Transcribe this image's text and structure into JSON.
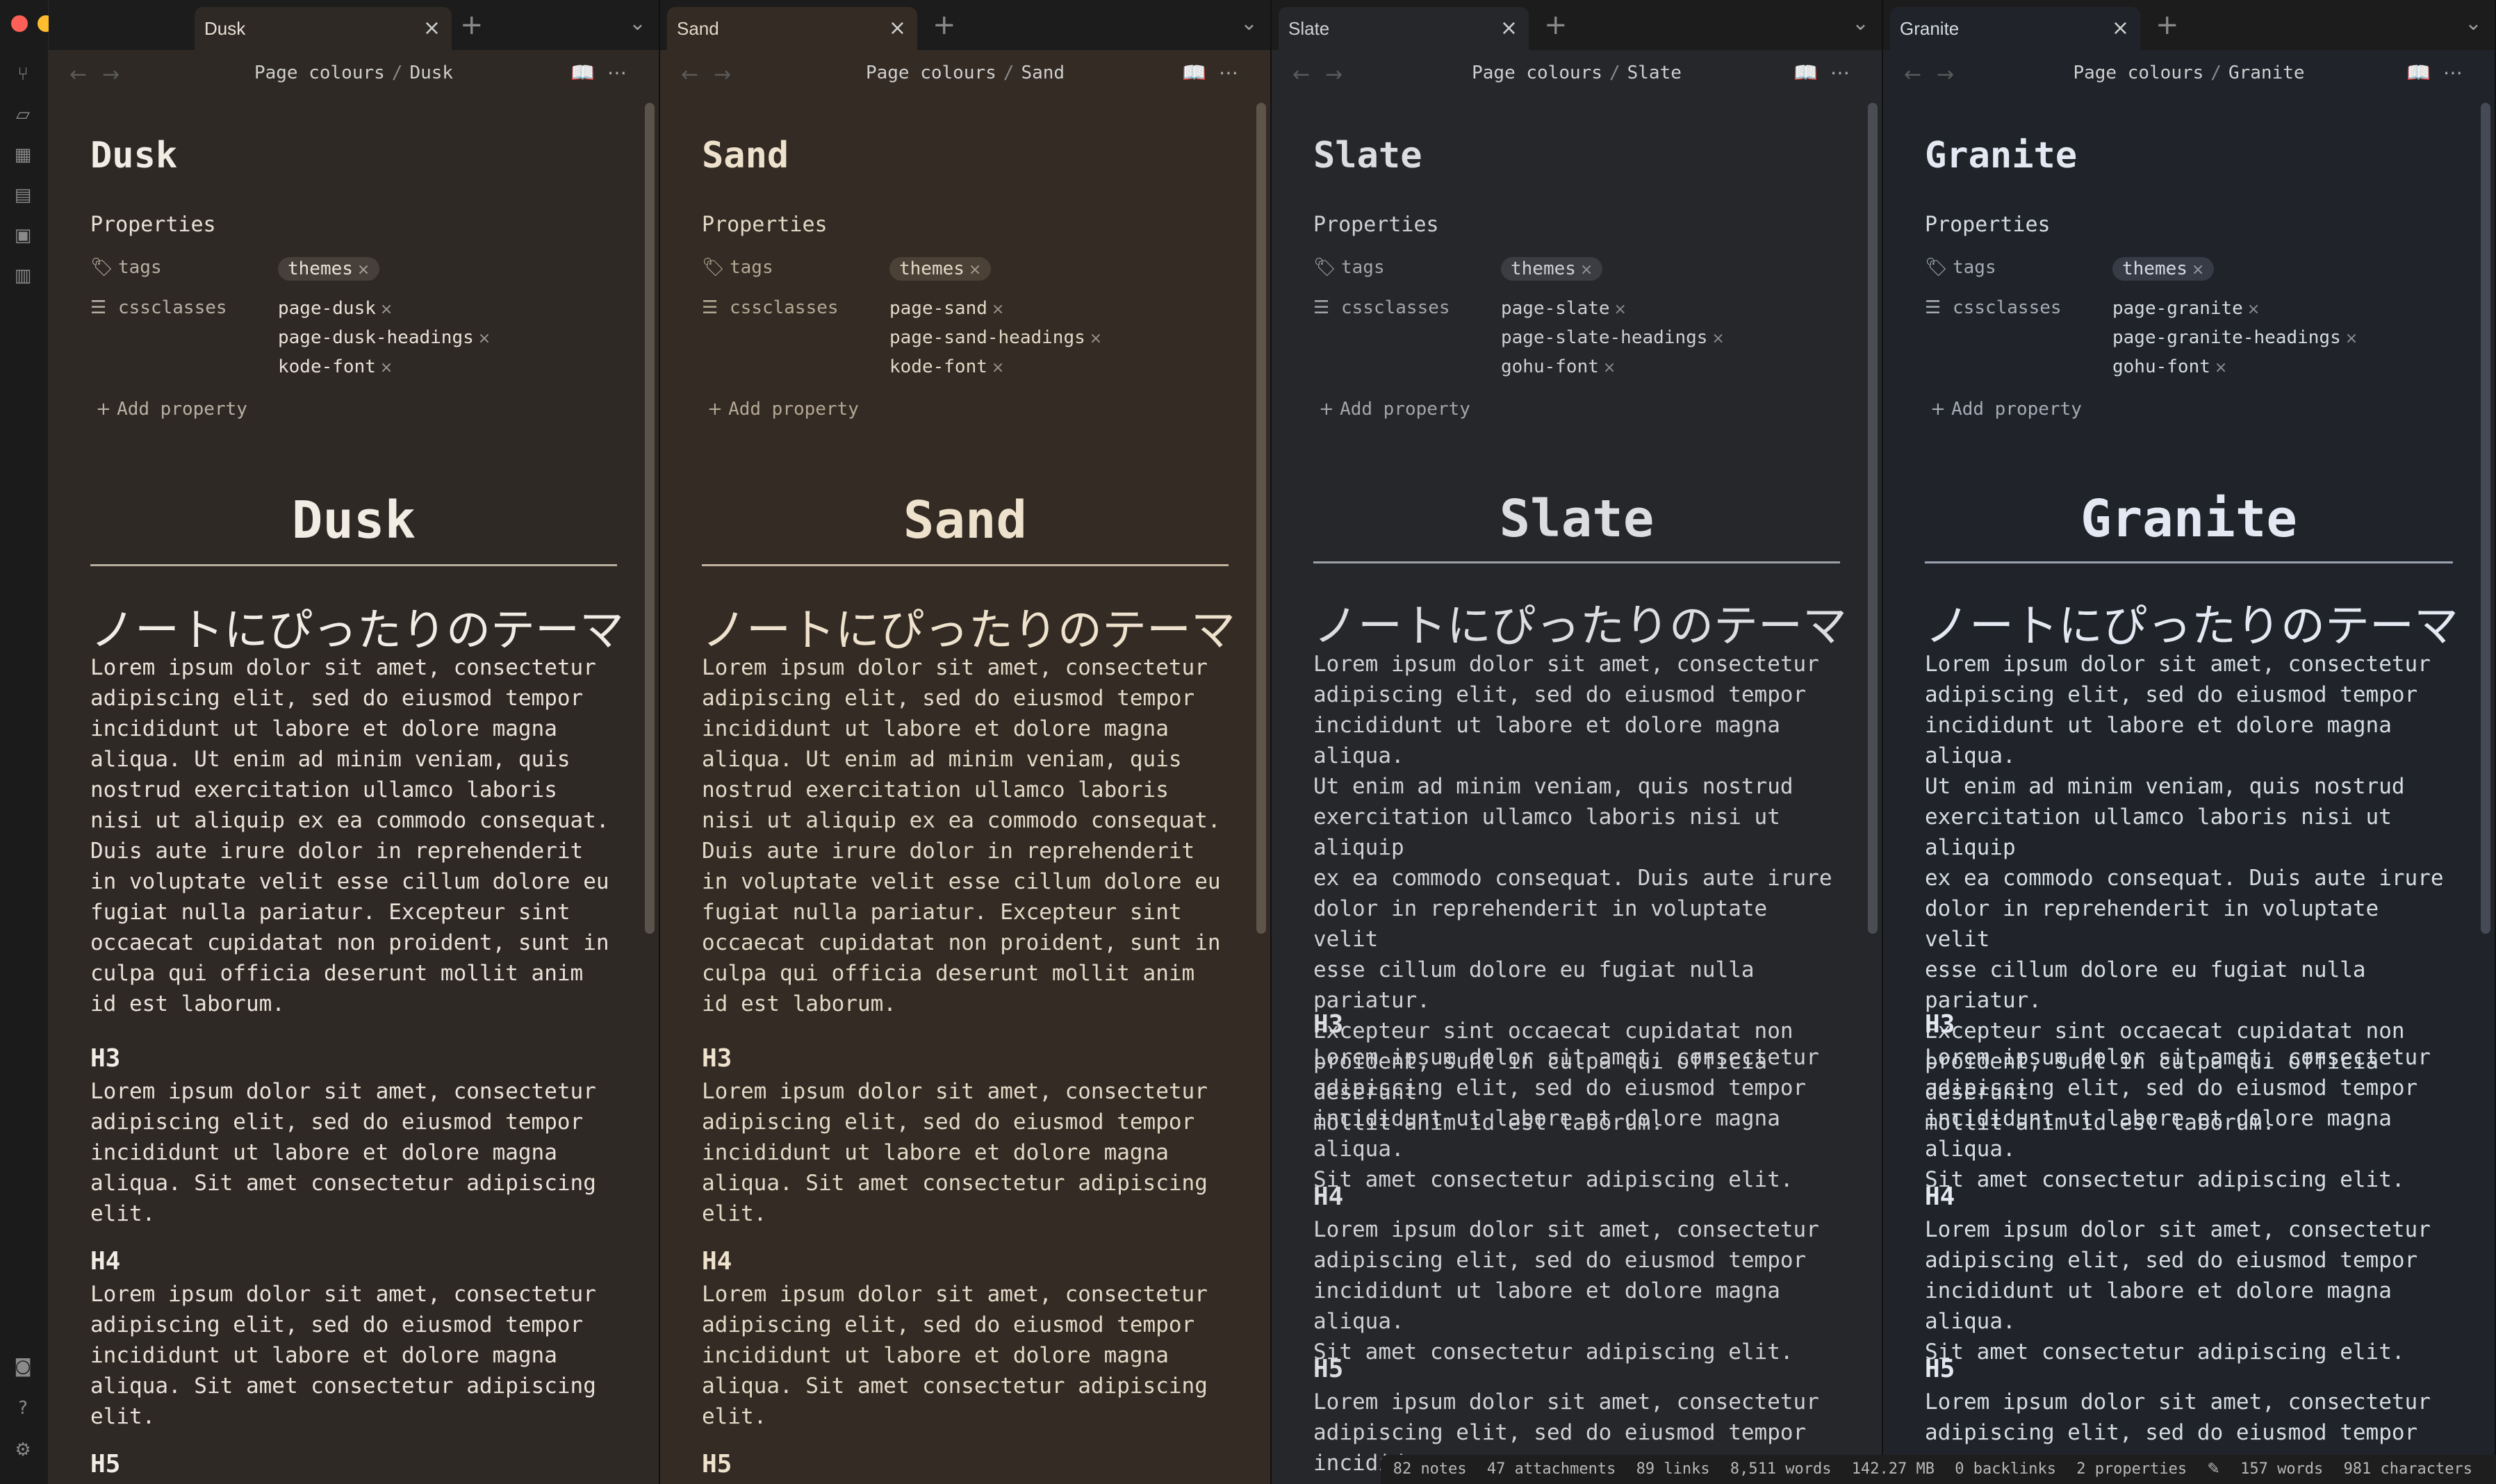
{
  "window": {
    "ribbon_icons": [
      "graph-icon",
      "canvas-icon",
      "grid-icon",
      "kanban-icon",
      "calendar-icon",
      "template-icon"
    ],
    "ribbon_bottom_icons": [
      "vault-icon",
      "help-icon",
      "settings-icon"
    ]
  },
  "panes": [
    {
      "id": "dusk",
      "tab_label": "Dusk",
      "breadcrumb_parent": "Page colours",
      "breadcrumb_separator": "/",
      "breadcrumb_current": "Dusk",
      "inline_title": "Dusk",
      "properties_heading": "Properties",
      "tags_key": "tags",
      "tag_value": "themes",
      "cssclasses_key": "cssclasses",
      "cssclasses": [
        "page-dusk",
        "page-dusk-headings",
        "kode-font"
      ],
      "add_property": "Add property",
      "h1": "Dusk",
      "h2": "ノートにぴったりのテーマ",
      "intro": "Lorem ipsum dolor sit amet, consectetur\nadipiscing elit, sed do eiusmod tempor\nincididunt ut labore et dolore magna\naliqua. Ut enim ad minim veniam, quis\nnostrud exercitation ullamco laboris\nnisi ut aliquip ex ea commodo consequat.\nDuis aute irure dolor in reprehenderit\nin voluptate velit esse cillum dolore eu\nfugiat nulla pariatur. Excepteur sint\noccaecat cupidatat non proident, sunt in\nculpa qui officia deserunt mollit anim\nid est laborum.",
      "h3": "H3",
      "h3_text": "Lorem ipsum dolor sit amet, consectetur\nadipiscing elit, sed do eiusmod tempor\nincididunt ut labore et dolore magna\naliqua. Sit amet consectetur adipiscing\nelit.",
      "h4": "H4",
      "h4_text": "Lorem ipsum dolor sit amet, consectetur\nadipiscing elit, sed do eiusmod tempor\nincididunt ut labore et dolore magna\naliqua. Sit amet consectetur adipiscing\nelit.",
      "h5": "H5",
      "h5_text": "",
      "colors": {
        "bg": "#2e2924",
        "tab": "#2e2924",
        "text": "#e8e2d8",
        "muted": "#b8b0a4",
        "heading": "#f1ece4",
        "pill_bg": "#47403a",
        "rule": "#b7ad9f",
        "scroll": "#5a534c"
      }
    },
    {
      "id": "sand",
      "tab_label": "Sand",
      "breadcrumb_parent": "Page colours",
      "breadcrumb_separator": "/",
      "breadcrumb_current": "Sand",
      "inline_title": "Sand",
      "properties_heading": "Properties",
      "tags_key": "tags",
      "tag_value": "themes",
      "cssclasses_key": "cssclasses",
      "cssclasses": [
        "page-sand",
        "page-sand-headings",
        "kode-font"
      ],
      "add_property": "Add property",
      "h1": "Sand",
      "h2": "ノートにぴったりのテーマ",
      "intro": "Lorem ipsum dolor sit amet, consectetur\nadipiscing elit, sed do eiusmod tempor\nincididunt ut labore et dolore magna\naliqua. Ut enim ad minim veniam, quis\nnostrud exercitation ullamco laboris\nnisi ut aliquip ex ea commodo consequat.\nDuis aute irure dolor in reprehenderit\nin voluptate velit esse cillum dolore eu\nfugiat nulla pariatur. Excepteur sint\noccaecat cupidatat non proident, sunt in\nculpa qui officia deserunt mollit anim\nid est laborum.",
      "h3": "H3",
      "h3_text": "Lorem ipsum dolor sit amet, consectetur\nadipiscing elit, sed do eiusmod tempor\nincididunt ut labore et dolore magna\naliqua. Sit amet consectetur adipiscing\nelit.",
      "h4": "H4",
      "h4_text": "Lorem ipsum dolor sit amet, consectetur\nadipiscing elit, sed do eiusmod tempor\nincididunt ut labore et dolore magna\naliqua. Sit amet consectetur adipiscing\nelit.",
      "h5": "H5",
      "h5_text": "",
      "colors": {
        "bg": "#332b24",
        "tab": "#332b24",
        "text": "#e4d8c6",
        "muted": "#b5a893",
        "heading": "#efe2cd",
        "pill_bg": "#4b4137",
        "rule": "#c2b39c",
        "scroll": "#5e5449"
      }
    },
    {
      "id": "slate",
      "tab_label": "Slate",
      "breadcrumb_parent": "Page colours",
      "breadcrumb_separator": "/",
      "breadcrumb_current": "Slate",
      "inline_title": "Slate",
      "properties_heading": "Properties",
      "tags_key": "tags",
      "tag_value": "themes",
      "cssclasses_key": "cssclasses",
      "cssclasses": [
        "page-slate",
        "page-slate-headings",
        "gohu-font"
      ],
      "add_property": "Add property",
      "h1": "Slate",
      "h2": "ノートにぴったりのテーマ",
      "intro": "Lorem ipsum dolor sit amet, consectetur\nadipiscing elit, sed do eiusmod tempor\nincididunt ut labore et dolore magna aliqua.\nUt enim ad minim veniam, quis nostrud\nexercitation ullamco laboris nisi ut aliquip\nex ea commodo consequat. Duis aute irure\ndolor in reprehenderit in voluptate velit\nesse cillum dolore eu fugiat nulla pariatur.\nExcepteur sint occaecat cupidatat non\nproident, sunt in culpa qui officia deserunt\nmollit anim id est laborum.",
      "h3": "H3",
      "h3_text": "Lorem ipsum dolor sit amet, consectetur\nadipiscing elit, sed do eiusmod tempor\nincididunt ut labore et dolore magna aliqua.\nSit amet consectetur adipiscing elit.",
      "h4": "H4",
      "h4_text": "Lorem ipsum dolor sit amet, consectetur\nadipiscing elit, sed do eiusmod tempor\nincididunt ut labore et dolore magna aliqua.\nSit amet consectetur adipiscing elit.",
      "h5": "H5",
      "h5_text": "Lorem ipsum dolor sit amet, consectetur\nadipiscing elit, sed do eiusmod tempor\nincididunt ut",
      "colors": {
        "bg": "#25272b",
        "tab": "#25272b",
        "text": "#cfd0d2",
        "muted": "#a3a5a9",
        "heading": "#dcdde0",
        "pill_bg": "#3b3d42",
        "rule": "#9ea2a8",
        "scroll": "#4a4d53"
      }
    },
    {
      "id": "granite",
      "tab_label": "Granite",
      "breadcrumb_parent": "Page colours",
      "breadcrumb_separator": "/",
      "breadcrumb_current": "Granite",
      "inline_title": "Granite",
      "properties_heading": "Properties",
      "tags_key": "tags",
      "tag_value": "themes",
      "cssclasses_key": "cssclasses",
      "cssclasses": [
        "page-granite",
        "page-granite-headings",
        "gohu-font"
      ],
      "add_property": "Add property",
      "h1": "Granite",
      "h2": "ノートにぴったりのテーマ",
      "intro": "Lorem ipsum dolor sit amet, consectetur\nadipiscing elit, sed do eiusmod tempor\nincididunt ut labore et dolore magna aliqua.\nUt enim ad minim veniam, quis nostrud\nexercitation ullamco laboris nisi ut aliquip\nex ea commodo consequat. Duis aute irure\ndolor in reprehenderit in voluptate velit\nesse cillum dolore eu fugiat nulla pariatur.\nExcepteur sint occaecat cupidatat non\nproident, sunt in culpa qui officia deserunt\nmollit anim id est laborum.",
      "h3": "H3",
      "h3_text": "Lorem ipsum dolor sit amet, consectetur\nadipiscing elit, sed do eiusmod tempor\nincididunt ut labore et dolore magna aliqua.\nSit amet consectetur adipiscing elit.",
      "h4": "H4",
      "h4_text": "Lorem ipsum dolor sit amet, consectetur\nadipiscing elit, sed do eiusmod tempor\nincididunt ut labore et dolore magna aliqua.\nSit amet consectetur adipiscing elit.",
      "h5": "H5",
      "h5_text": "Lorem ipsum dolor sit amet, consectetur\nadipiscing elit, sed do eiusmod tempor",
      "colors": {
        "bg": "#20232a",
        "tab": "#20232a",
        "text": "#d6dae3",
        "muted": "#a6abb6",
        "heading": "#e3e8f2",
        "pill_bg": "#363b46",
        "rule": "#9aa2b2",
        "scroll": "#454a55"
      }
    }
  ],
  "statusbar": {
    "notes": "82 notes",
    "attachments": "47 attachments",
    "links": "89 links",
    "words_total": "8,511 words",
    "size": "142.27 MB",
    "backlinks": "0 backlinks",
    "properties": "2 properties",
    "words": "157 words",
    "characters": "981 characters"
  }
}
